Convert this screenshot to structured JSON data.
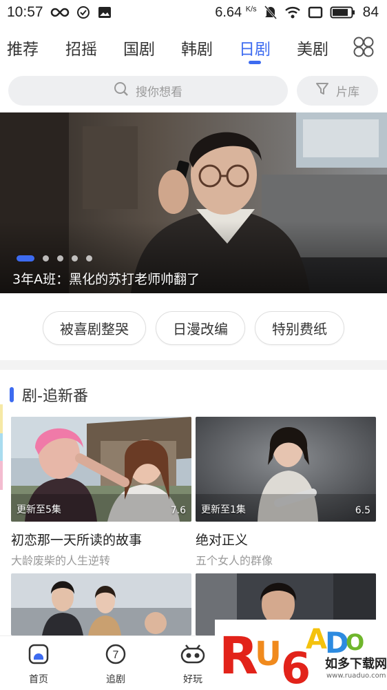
{
  "status_bar": {
    "time": "10:57",
    "speed": "6.64",
    "speed_unit": "K/s",
    "battery": "84"
  },
  "tabs": [
    {
      "label": "推荐",
      "active": false
    },
    {
      "label": "招摇",
      "active": false
    },
    {
      "label": "国剧",
      "active": false
    },
    {
      "label": "韩剧",
      "active": false
    },
    {
      "label": "日剧",
      "active": true
    },
    {
      "label": "美剧",
      "active": false
    }
  ],
  "search": {
    "placeholder": "搜你想看",
    "library_label": "片库"
  },
  "banner": {
    "caption": "3年A班：黑化的苏打老师帅翻了",
    "dot_count": 5,
    "active_dot": 0
  },
  "chips": [
    "被喜剧整哭",
    "日漫改编",
    "特别费纸"
  ],
  "section": {
    "title": "剧-追新番"
  },
  "cards": [
    {
      "update": "更新至5集",
      "score": "7.6",
      "title": "初恋那一天所读的故事",
      "subtitle": "大龄废柴的人生逆转"
    },
    {
      "update": "更新至1集",
      "score": "6.5",
      "title": "绝对正义",
      "subtitle": "五个女人的群像"
    }
  ],
  "bottom_nav": [
    {
      "label": "首页",
      "icon": "home-icon",
      "active": true
    },
    {
      "label": "追剧",
      "icon": "follow-icon",
      "active": false
    },
    {
      "label": "好玩",
      "icon": "game-icon",
      "active": false
    }
  ],
  "watermark": {
    "brand": "RUANDADO",
    "text": "如多下载网",
    "url": "www.ruaduo.com"
  },
  "colors": {
    "accent": "#3d6bf0",
    "text": "#222222",
    "muted": "#999999",
    "chip_bg": "#eeeff1"
  }
}
